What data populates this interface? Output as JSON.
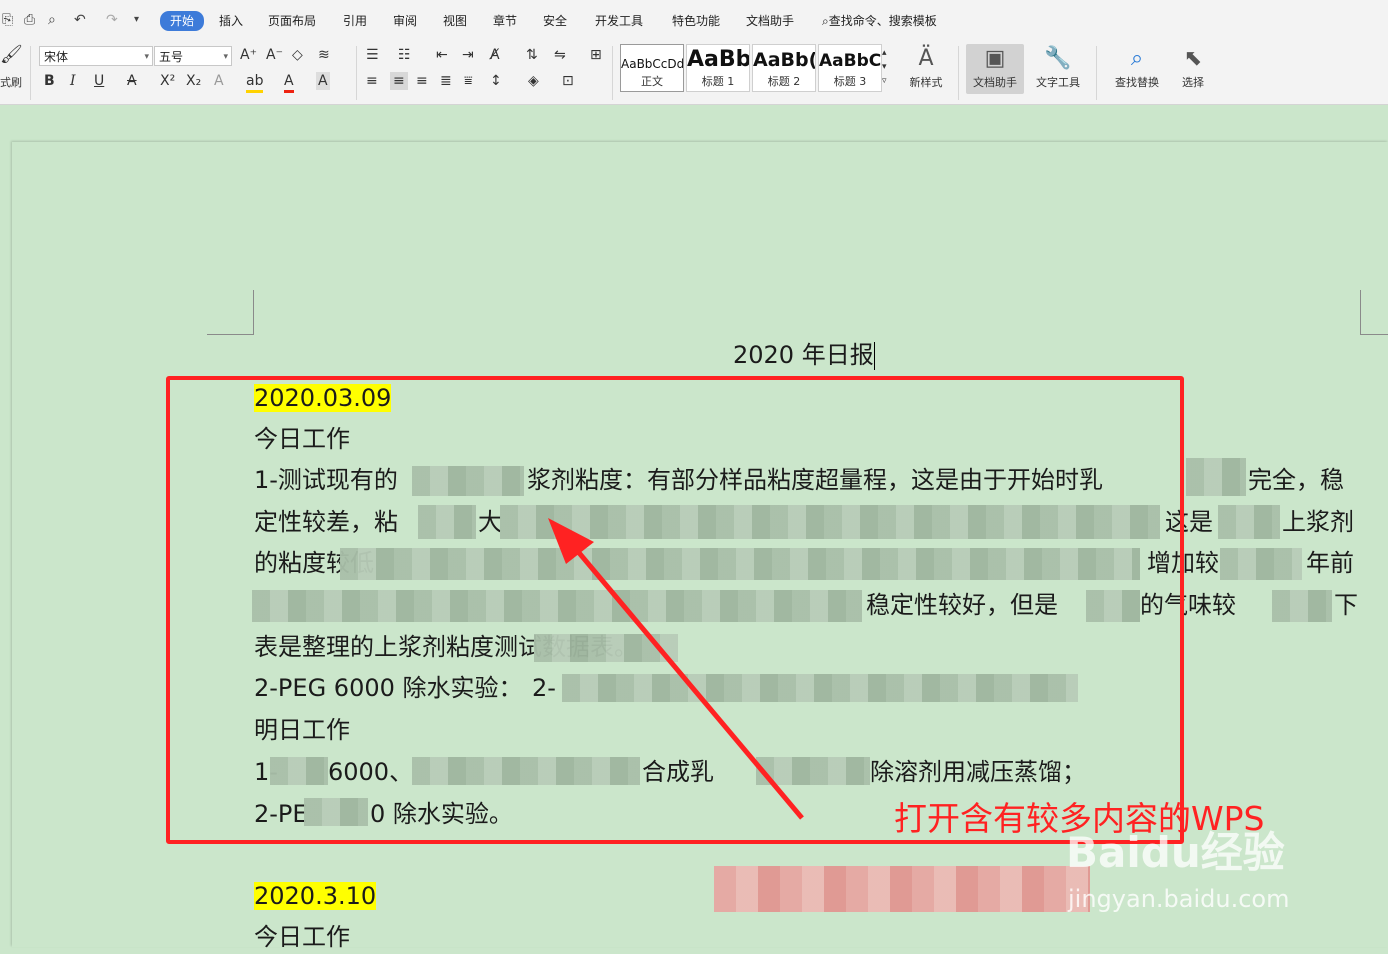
{
  "menu": {
    "tabs": [
      "开始",
      "插入",
      "页面布局",
      "引用",
      "审阅",
      "视图",
      "章节",
      "安全",
      "开发工具",
      "特色功能",
      "文档助手"
    ],
    "active_tab": "开始",
    "search_placeholder": "查找命令、搜索模板"
  },
  "ribbon": {
    "format_painter_label": "式刷",
    "font_name": "宋体",
    "font_size": "五号",
    "styles": [
      {
        "sample": "AaBbCcDd",
        "name": "正文"
      },
      {
        "sample": "AaBb",
        "name": "标题 1"
      },
      {
        "sample": "AaBb(",
        "name": "标题 2"
      },
      {
        "sample": "AaBbC",
        "name": "标题 3"
      }
    ],
    "new_style_label": "新样式",
    "doc_assistant_label": "文档助手",
    "text_tools_label": "文字工具",
    "find_replace_label": "查找替换",
    "select_label": "选择"
  },
  "document": {
    "title": "2020 年日报",
    "entries": [
      {
        "date": "2020.03.09",
        "today_heading": "今日工作",
        "lines": [
          "1-测试现有的",
          "浆剂粘度：有部分样品粘度超量程，这是由于开始时乳",
          "完全，稳",
          "定性较差，粘",
          "大",
          "这是",
          "上浆剂",
          "的粘度较低",
          "增加较",
          "年前",
          "稳定性较好，但是",
          "的气味较",
          "下",
          "表是整理的上浆剂粘度测试数据表。",
          "2-PEG 6000 除水实验：",
          "2-",
          "明日工作",
          "1-",
          "6000、",
          "合成乳",
          "除溶剂用减压蒸馏；",
          "2-PE",
          "0 除水实验。"
        ]
      },
      {
        "date": "2020.3.10",
        "today_heading": "今日工作"
      }
    ],
    "annotation": "打开含有较多内容的WPS"
  },
  "watermark": {
    "brand": "Baidu经验",
    "url": "jingyan.baidu.com"
  },
  "colors": {
    "annotation_red": "#ff2222",
    "highlight": "#ffff00",
    "page_bg": "#cbe6cb",
    "tab_active": "#3d7bd9"
  }
}
